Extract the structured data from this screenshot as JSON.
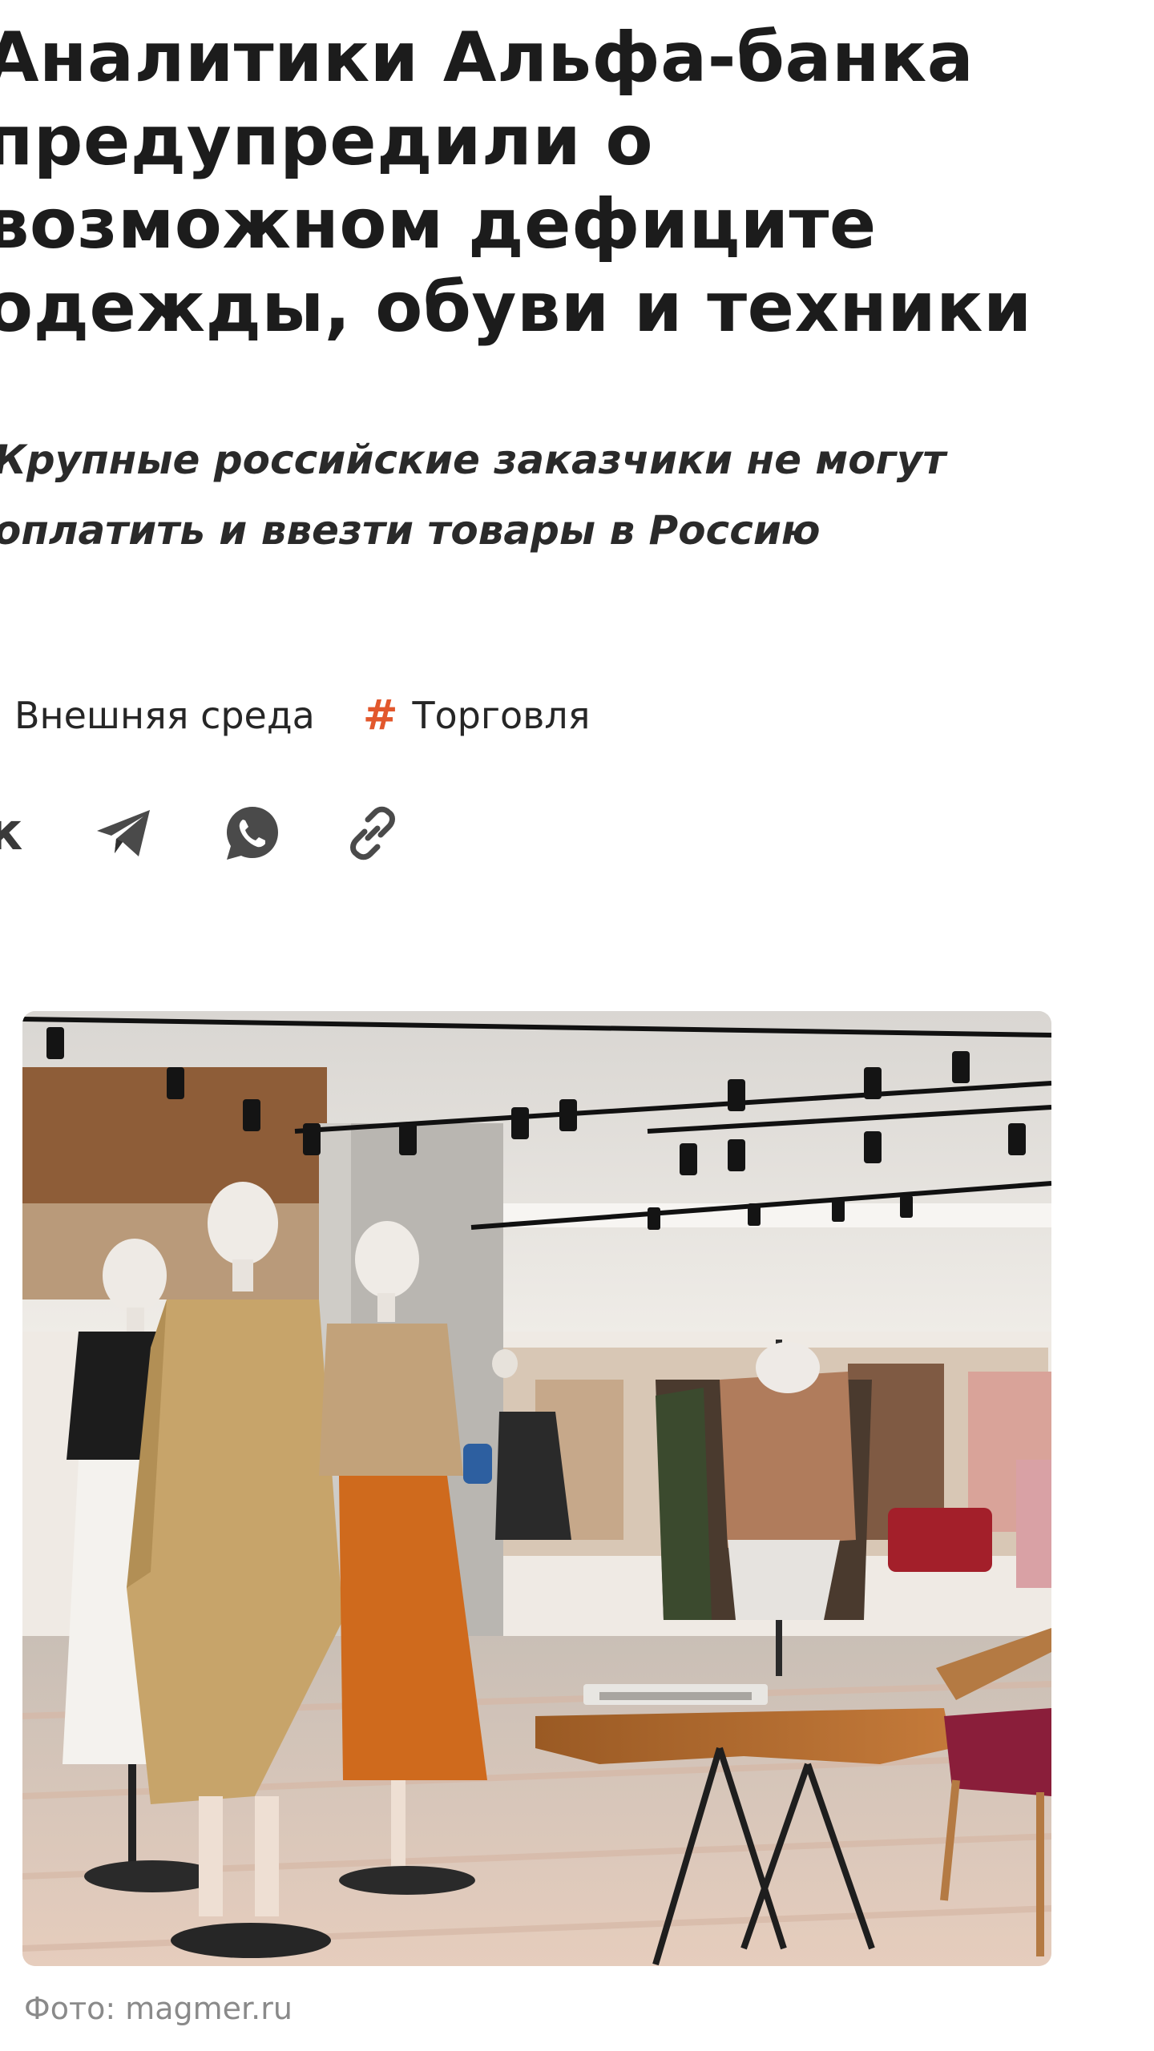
{
  "article": {
    "title": "Аналитики Альфа-банка предупредили о возможном дефиците одежды, обуви и техники",
    "subtitle": "Крупные российские заказчики не могут оплатить и ввезти товары в Россию"
  },
  "tags": [
    {
      "label": "Внешняя среда",
      "icon": "hash-icon"
    },
    {
      "label": "Торговля",
      "icon": "hash-icon"
    }
  ],
  "share": {
    "buttons": [
      {
        "icon": "vk-icon"
      },
      {
        "icon": "telegram-icon"
      },
      {
        "icon": "whatsapp-icon"
      },
      {
        "icon": "copy-link-icon"
      }
    ]
  },
  "photo": {
    "caption": "Фото: magmer.ru",
    "description_icon": "store-interior-photo"
  },
  "colors": {
    "accent": "#e2572c",
    "text": "#1f1f1f",
    "icon": "#3a3a3a",
    "caption": "#8a8a8a"
  }
}
